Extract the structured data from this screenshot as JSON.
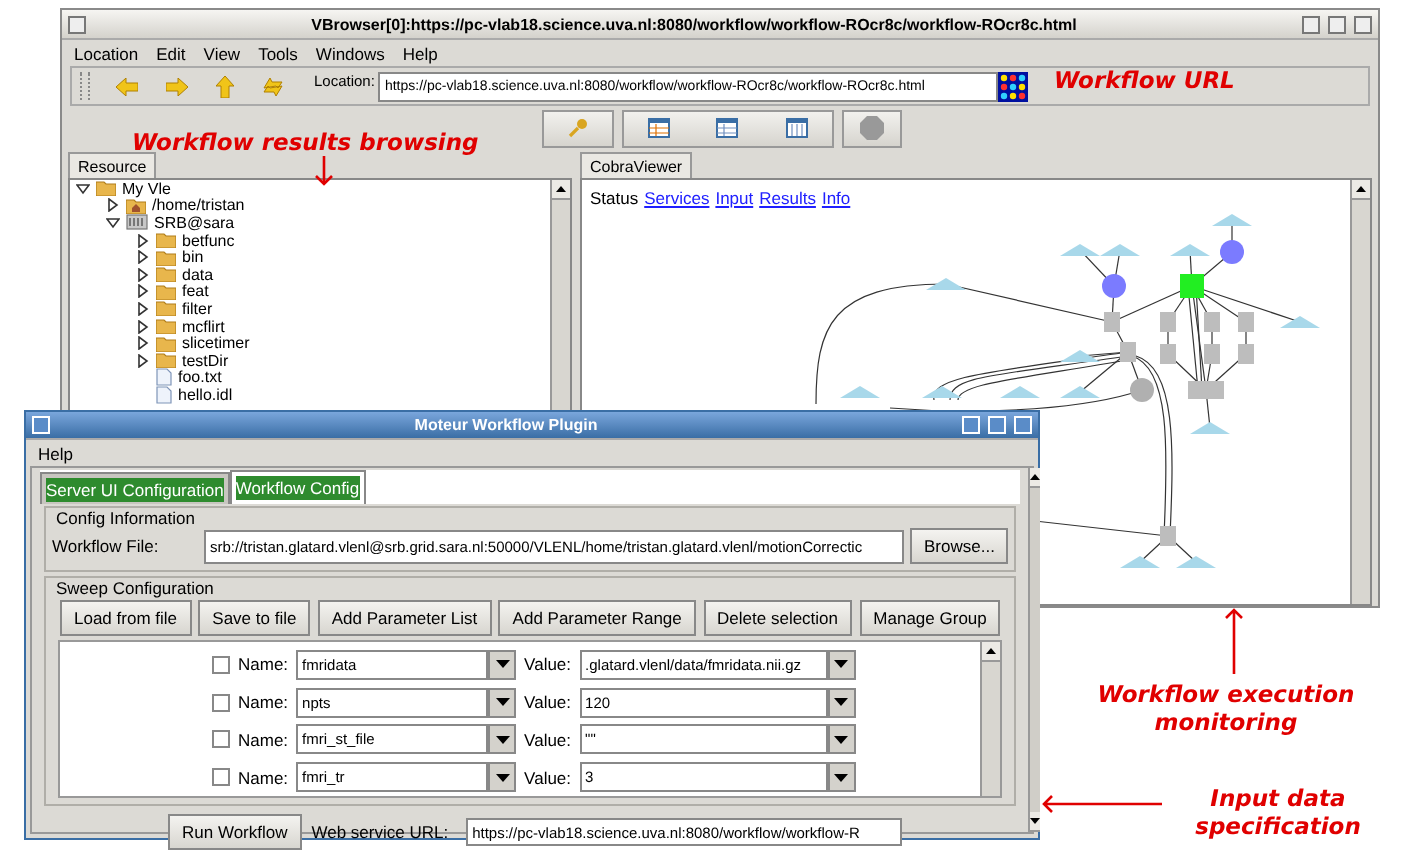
{
  "browser": {
    "title": "VBrowser[0]:https://pc-vlab18.science.uva.nl:8080/workflow/workflow-ROcr8c/workflow-ROcr8c.html",
    "menu": [
      "Location",
      "Edit",
      "View",
      "Tools",
      "Windows",
      "Help"
    ],
    "location_label": "Location:",
    "location": "https://pc-vlab18.science.uva.nl:8080/workflow/workflow-ROcr8c/workflow-ROcr8c.html",
    "left_tabs": [
      {
        "label": "Resource",
        "selected": true
      }
    ],
    "tree": [
      {
        "label": "My Vle",
        "kind": "folder",
        "expanded": true,
        "children": [
          {
            "label": "/home/tristan",
            "kind": "home",
            "expanded": false
          },
          {
            "label": "SRB@sara",
            "kind": "server",
            "expanded": true,
            "children": [
              {
                "label": "betfunc",
                "kind": "folder",
                "expanded": false
              },
              {
                "label": "bin",
                "kind": "folder",
                "expanded": false
              },
              {
                "label": "data",
                "kind": "folder",
                "expanded": false
              },
              {
                "label": "feat",
                "kind": "folder",
                "expanded": false
              },
              {
                "label": "filter",
                "kind": "folder",
                "expanded": false
              },
              {
                "label": "mcflirt",
                "kind": "folder",
                "expanded": false
              },
              {
                "label": "slicetimer",
                "kind": "folder",
                "expanded": false
              },
              {
                "label": "testDir",
                "kind": "folder",
                "expanded": false
              },
              {
                "label": "foo.txt",
                "kind": "file"
              },
              {
                "label": "hello.idl",
                "kind": "file"
              }
            ]
          }
        ]
      }
    ],
    "right_tabs": [
      {
        "label": "CobraViewer",
        "selected": true
      }
    ],
    "viewer": {
      "status": "Status",
      "links": [
        "Services",
        "Input",
        "Results",
        "Info"
      ]
    }
  },
  "plugin": {
    "title": "Moteur Workflow Plugin",
    "menu": [
      "Help"
    ],
    "tabs": [
      {
        "label": "Server UI Configuration",
        "selected": false
      },
      {
        "label": "Workflow Config",
        "selected": true
      }
    ],
    "config": {
      "legend": "Config Information",
      "label": "Workflow File:",
      "value": "srb://tristan.glatard.vlenl@srb.grid.sara.nl:50000/VLENL/home/tristan.glatard.vlenl/motionCorrectic",
      "button": "Browse..."
    },
    "sweep": {
      "legend": "Sweep Configuration",
      "buttons": [
        "Load from file",
        "Save to file",
        "Add Parameter List",
        "Add Parameter Range",
        "Delete selection",
        "Manage Group"
      ],
      "parameters": [
        {
          "checked": false,
          "name_label": "Name:",
          "name": "fmridata",
          "value_label": "Value:",
          "value": ".glatard.vlenl/data/fmridata.nii.gz"
        },
        {
          "checked": false,
          "name_label": "Name:",
          "name": "npts",
          "value_label": "Value:",
          "value": "120"
        },
        {
          "checked": false,
          "name_label": "Name:",
          "name": "fmri_st_file",
          "value_label": "Value:",
          "value": "\"\""
        },
        {
          "checked": false,
          "name_label": "Name:",
          "name": "fmri_tr",
          "value_label": "Value:",
          "value": "3"
        }
      ]
    },
    "run_button": "Run Workflow",
    "url_label": "Web service URL:",
    "url": "https://pc-vlab18.science.uva.nl:8080/workflow/workflow-R"
  },
  "annotations": [
    {
      "text": "Workflow URL"
    },
    {
      "text": "Workflow results browsing"
    },
    {
      "text": "Workflow execution monitoring"
    },
    {
      "text": "Input data specification"
    }
  ]
}
